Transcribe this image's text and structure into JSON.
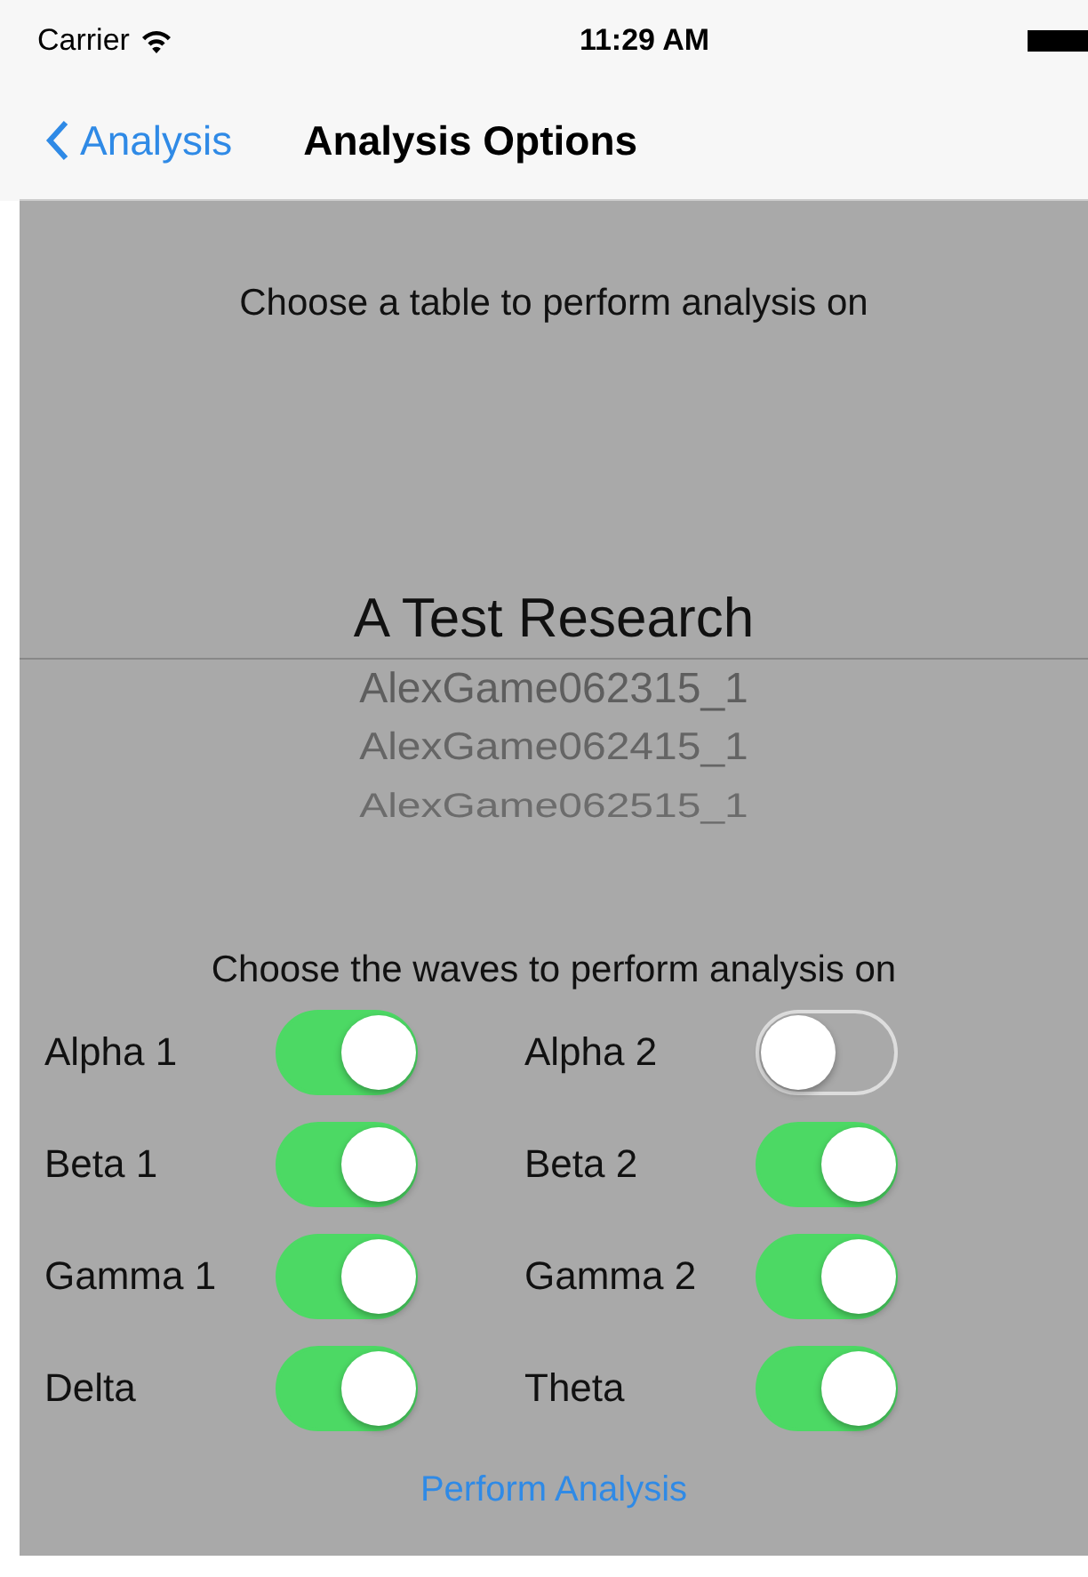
{
  "status_bar": {
    "carrier": "Carrier",
    "time": "11:29 AM"
  },
  "nav": {
    "back": "Analysis",
    "title": "Analysis Options"
  },
  "table_prompt": "Choose a table to perform analysis on",
  "picker": [
    {
      "label": "A Test Research",
      "selected": true
    },
    {
      "label": "AlexGame062315_1",
      "selected": false
    },
    {
      "label": "AlexGame062415_1",
      "selected": false
    },
    {
      "label": "AlexGame062515_1",
      "selected": false
    }
  ],
  "waves_prompt": "Choose the waves to perform analysis on",
  "waves": [
    {
      "label": "Alpha 1",
      "on": true
    },
    {
      "label": "Alpha 2",
      "on": false
    },
    {
      "label": "Beta 1",
      "on": true
    },
    {
      "label": "Beta 2",
      "on": true
    },
    {
      "label": "Gamma 1",
      "on": true
    },
    {
      "label": "Gamma 2",
      "on": true
    },
    {
      "label": "Delta",
      "on": true
    },
    {
      "label": "Theta",
      "on": true
    }
  ],
  "action": "Perform Analysis"
}
